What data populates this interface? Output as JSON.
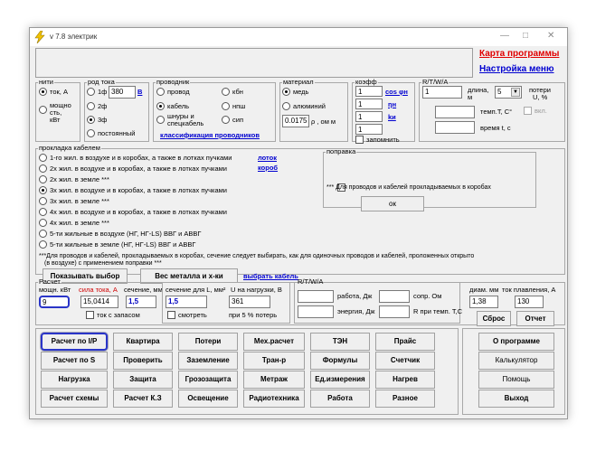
{
  "window": {
    "title": "v 7.8 электрик",
    "minimize": "—",
    "maximize": "□",
    "close": "✕"
  },
  "toplinks": {
    "program_map": "Карта программы",
    "menu_settings": "Настройка меню"
  },
  "threads": {
    "legend": "нити",
    "opt1": "ток, А",
    "opt2_l1": "мощно",
    "opt2_l2": "сть,",
    "opt2_l3": "кВт"
  },
  "current_type": {
    "legend": "род тока",
    "opt1": "1ф",
    "value": "380",
    "unit": "В",
    "opt2": "2ф",
    "opt3": "3ф",
    "opt4": "постоянный"
  },
  "conductor": {
    "legend": "проводник",
    "opt1": "провод",
    "opt2": "кбн",
    "opt3": "кабель",
    "opt4": "нпш",
    "opt5_l1": "шнуры и",
    "opt5_l2": "спецкабель",
    "opt6": "сип",
    "link": "классификация проводников"
  },
  "material": {
    "legend": "материал",
    "opt1": "медь",
    "opt2": "алюминий",
    "rho_value": "0.0175",
    "rho_unit": "ρ , ом м"
  },
  "coef": {
    "legend": "коэфф",
    "v1": "1",
    "l1": "cos φн",
    "v2": "1",
    "l2": "ηн",
    "v3": "1",
    "l3": "kи",
    "v4": "1",
    "check": "запомнить"
  },
  "rlc": {
    "legend": "R/T/W/A",
    "value": "1",
    "length_l1": "длина,",
    "length_l2": "м",
    "loss_value": "5",
    "loss_l1": "потери",
    "loss_l2": "U, %",
    "temp_label": "темп.T, С°",
    "incl_label": "вкл.",
    "time_label": "время t, с"
  },
  "laying": {
    "legend": "прокладка кабелем",
    "options": [
      "1-го жил. в воздухе и в коробах, а также в лотках пучками",
      "2х жил. в воздухе и в коробах, а также в лотках пучками",
      "2х жил. в земле ***",
      "3х жил. в воздухе и в коробах, а также в лотках пучками",
      "3х жил. в земле ***",
      "4х жил. в воздухе и в коробах, а также в лотках пучками",
      "4х жил. в земле ***",
      "5-ти жильные в воздухе (НГ, НГ-LS) ВВГ и АВВГ",
      "5-ти жильные в земле (НГ, НГ-LS) ВВГ и АВВГ"
    ],
    "tray": "лоток",
    "box": "короб",
    "note_l1": "***Для проводов и кабелей, прокладываемых в коробах, сечение следует выбирать, как для одиночных проводов и кабелей, проложенных открыто",
    "note_l2": "(в воздухе) с применением поправки ***",
    "btn_show": "Показывать выбор",
    "btn_weight": "Вес металла и х-ки",
    "link_cable": "выбрать кабель"
  },
  "correction": {
    "legend": "поправка",
    "check": "*** Для проводов и кабелей прокладываемых в коробах",
    "ok": "ок"
  },
  "calc": {
    "legend": "Расчет",
    "power_label": "мощн. кВт",
    "power_value": "9",
    "current_label": "сила тока, А",
    "section_label": "сечение, мм²",
    "current_value": "15,0414",
    "section_value": "1,5",
    "reserve": "ток с запасом",
    "section_L_label": "сечение для L, мм²",
    "section_L_value": "1,5",
    "u_load_label": "U на нагрузки, В",
    "u_load_value": "361",
    "view": "смотреть",
    "loss_label": "при 5 % потерь",
    "rtwa_legend": "R/T/W/A",
    "work_label": "работа, Дж",
    "resist_label": "сопр. Ом",
    "energy_label": "энергия, Дж",
    "rtemp_label": "R при темп. T,С",
    "diam_label": "диам. мм",
    "melt_label": "ток плавления, А",
    "diam_value": "1,38",
    "melt_value": "130",
    "reset": "Сброс",
    "report": "Отчет"
  },
  "buttons": {
    "row1": [
      "Расчет по I/P",
      "Квартира",
      "Потери",
      "Мех.расчет",
      "ТЭН",
      "Прайс"
    ],
    "row2": [
      "Расчет по S",
      "Проверить",
      "Заземление",
      "Тран-р",
      "Формулы",
      "Счетчик"
    ],
    "row3": [
      "Нагрузка",
      "Защита",
      "Грозозащита",
      "Метраж",
      "Ед.измерения",
      "Нагрев"
    ],
    "row4": [
      "Расчет схемы",
      "Расчет К.З",
      "Освещение",
      "Радиотехника",
      "Работа",
      "Разное"
    ]
  },
  "side": {
    "about": "О программе",
    "calculator": "Калькулятор",
    "help": "Помощь",
    "exit": "Выход"
  }
}
